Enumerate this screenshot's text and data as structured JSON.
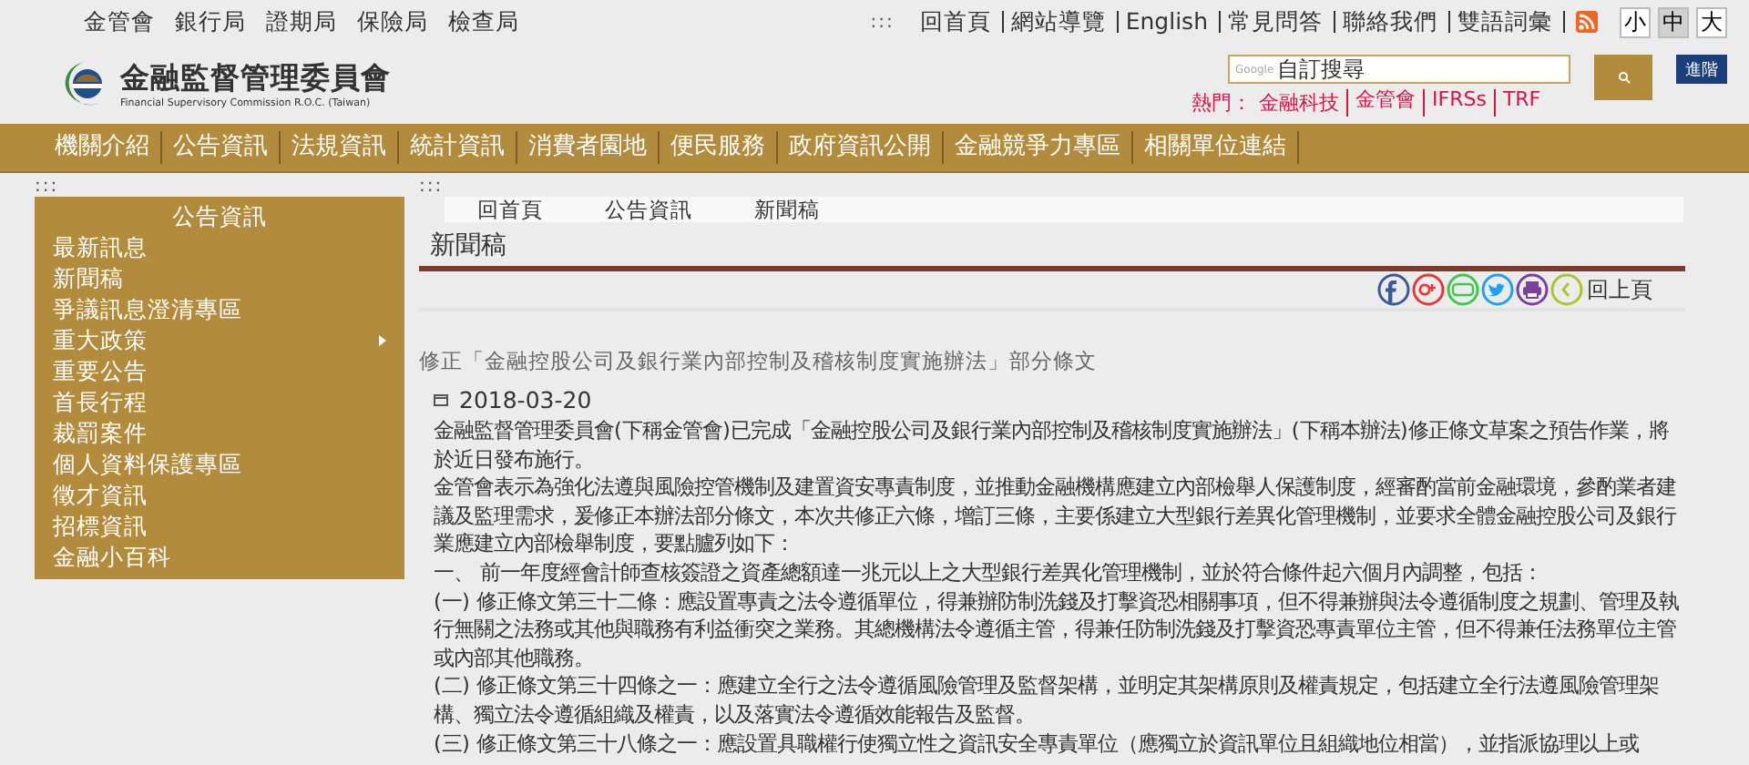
{
  "top_links": [
    "金管會",
    "銀行局",
    "證期局",
    "保險局",
    "檢查局"
  ],
  "utility_links": [
    "回首頁",
    "網站導覽",
    "English",
    "常見問答",
    "聯絡我們",
    "雙語詞彙"
  ],
  "accesskey_marks": [
    ":::",
    ":::",
    ":::"
  ],
  "font_sizes": [
    {
      "label": "小",
      "selected": false
    },
    {
      "label": "中",
      "selected": true
    },
    {
      "label": "大",
      "selected": false
    }
  ],
  "logo": {
    "title": "金融監督管理委員會",
    "subtitle": "Financial Supervisory Commission R.O.C. (Taiwan)"
  },
  "search": {
    "brand": "Google",
    "placeholder": "自訂搜尋",
    "advanced": "進階"
  },
  "hot": {
    "label": "熱門：",
    "links": [
      "金融科技",
      "金管會",
      "IFRSs",
      "TRF"
    ]
  },
  "nav": [
    "機關介紹",
    "公告資訊",
    "法規資訊",
    "統計資訊",
    "消費者園地",
    "便民服務",
    "政府資訊公開",
    "金融競爭力專區",
    "相關單位連結"
  ],
  "sidebar": {
    "title": "公告資訊",
    "items": [
      {
        "label": "最新訊息",
        "has_submenu": false
      },
      {
        "label": "新聞稿",
        "has_submenu": false
      },
      {
        "label": "爭議訊息澄清專區",
        "has_submenu": false
      },
      {
        "label": "重大政策",
        "has_submenu": true
      },
      {
        "label": "重要公告",
        "has_submenu": false
      },
      {
        "label": "首長行程",
        "has_submenu": false
      },
      {
        "label": "裁罰案件",
        "has_submenu": false
      },
      {
        "label": "個人資料保護專區",
        "has_submenu": false
      },
      {
        "label": "徵才資訊",
        "has_submenu": false
      },
      {
        "label": "招標資訊",
        "has_submenu": false
      },
      {
        "label": "金融小百科",
        "has_submenu": false
      }
    ]
  },
  "breadcrumb": [
    "回首頁",
    "公告資訊",
    "新聞稿"
  ],
  "page_title": "新聞稿",
  "share": [
    {
      "kind": "facebook"
    },
    {
      "kind": "googleplus"
    },
    {
      "kind": "line"
    },
    {
      "kind": "twitter"
    },
    {
      "kind": "print"
    },
    {
      "kind": "back"
    }
  ],
  "back_label": "回上頁",
  "article": {
    "title": "修正「金融控股公司及銀行業內部控制及稽核制度實施辦法」部分條文",
    "date": "2018-03-20",
    "paragraphs": [
      "金融監督管理委員會(下稱金管會)已完成「金融控股公司及銀行業內部控制及稽核制度實施辦法」(下稱本辦法)修正條文草案之預告作業，將於近日發布施行。",
      "金管會表示為強化法遵與風險控管機制及建置資安專責制度，並推動金融機構應建立內部檢舉人保護制度，經審酌當前金融環境，參酌業者建議及監理需求，爰修正本辦法部分條文，本次共修正六條，增訂三條，主要係建立大型銀行差異化管理機制，並要求全體金融控股公司及銀行業應建立內部檢舉制度，要點臚列如下：",
      "一、 前一年度經會計師查核簽證之資產總額達一兆元以上之大型銀行差異化管理機制，並於符合條件起六個月內調整，包括：",
      "(一) 修正條文第三十二條：應設置專責之法令遵循單位，得兼辦防制洗錢及打擊資恐相關事項，但不得兼辦與法令遵循制度之規劃、管理及執行無關之法務或其他與職務有利益衝突之業務。其總機構法令遵循主管，得兼任防制洗錢及打擊資恐專責單位主管，但不得兼任法務單位主管或內部其他職務。",
      "(二) 修正條文第三十四條之一：應建立全行之法令遵循風險管理及監督架構，並明定其架構原則及權責規定，包括建立全行法遵風險管理架構、獨立法令遵循組織及權責，以及落實法令遵循效能報告及監督。",
      "(三) 修正條文第三十八條之一：應設置具職權行使獨立性之資訊安全專責單位（應獨立於資訊單位且組織地位相當），並指派協理以上或"
    ]
  }
}
